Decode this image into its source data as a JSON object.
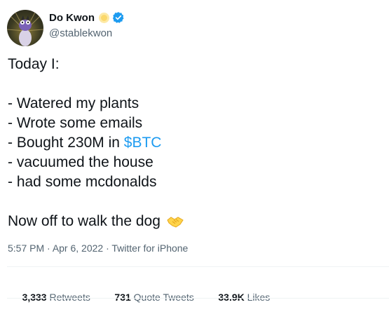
{
  "author": {
    "display_name": "Do Kwon",
    "handle": "@stablekwon",
    "avatar_icon": "frog-avatar",
    "badge_emoji_icon": "sun-emoji-icon",
    "verified_icon": "verified-badge-icon",
    "verified_color": "#1d9bf0"
  },
  "tweet": {
    "line1": "Today I:",
    "list": [
      "- Watered my plants",
      "- Wrote some emails",
      "- Bought 230M in ",
      "- vacuumed the house",
      "- had some mcdonalds"
    ],
    "cashtag": "$BTC",
    "closing": "Now off to walk the dog",
    "closing_emoji_icon": "handshake-emoji-icon",
    "link_color": "#1d9bf0"
  },
  "meta": {
    "time": "5:57 PM",
    "date": "Apr 6, 2022",
    "source": "Twitter for iPhone",
    "separator": " · "
  },
  "stats": [
    {
      "value": "3,333",
      "label": "Retweets"
    },
    {
      "value": "731",
      "label": "Quote Tweets"
    },
    {
      "value": "33.9K",
      "label": "Likes"
    }
  ]
}
